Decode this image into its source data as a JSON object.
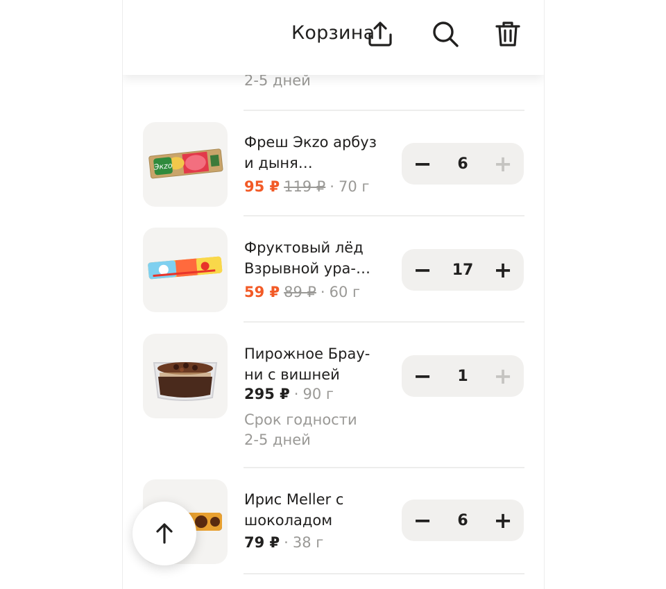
{
  "header": {
    "title": "Корзина",
    "icons": [
      "share-icon",
      "search-icon",
      "trash-icon"
    ]
  },
  "top_remnant": "2-5 дней",
  "items": [
    {
      "name": "Фреш Экzo арбуз и дыня…",
      "price": "95 ₽",
      "old_price": "119 ₽",
      "weight": "70 г",
      "quantity": "6",
      "on_sale": true,
      "plus_enabled": false
    },
    {
      "name": "Фруктовый лёд Взрывной ура-…",
      "price": "59 ₽",
      "old_price": "89 ₽",
      "weight": "60 г",
      "quantity": "17",
      "on_sale": true,
      "plus_enabled": true
    },
    {
      "name": "Пирожное Брау-ни с вишней",
      "price": "295 ₽",
      "weight": "90 г",
      "quantity": "1",
      "on_sale": false,
      "plus_enabled": false,
      "note_label": "Срок годности",
      "note_value": "2-5 дней"
    },
    {
      "name": "Ирис Meller с шоколадом",
      "price": "79 ₽",
      "weight": "38 г",
      "quantity": "6",
      "on_sale": false,
      "plus_enabled": true
    }
  ],
  "symbols": {
    "minus": "−",
    "plus": "+",
    "dot": "·"
  },
  "colors": {
    "sale": "#f25a26",
    "muted": "#9a9996",
    "stepper_bg": "#f1f0ee",
    "thumb_bg": "#f4f3f1"
  }
}
